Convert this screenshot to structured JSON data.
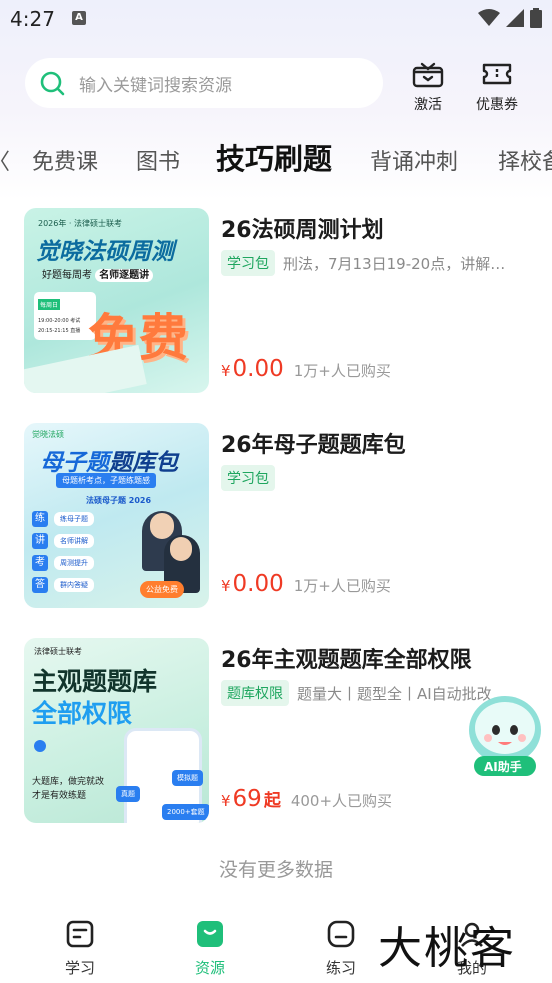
{
  "status_bar": {
    "time": "4:27",
    "notif_letter": "A"
  },
  "search": {
    "placeholder": "输入关键词搜索资源"
  },
  "top_actions": [
    {
      "label": "激活",
      "icon": "gift-icon"
    },
    {
      "label": "优惠券",
      "icon": "ticket-icon"
    }
  ],
  "tabs": [
    {
      "label": "免费课"
    },
    {
      "label": "图书"
    },
    {
      "label": "技巧刷题",
      "active": true
    },
    {
      "label": "背诵冲刺"
    },
    {
      "label": "择校备"
    }
  ],
  "products": [
    {
      "title": "26法硕周测计划",
      "tag": "学习包",
      "desc": "刑法，7月13日19-20点，讲解…",
      "price_symbol": "¥",
      "price": "0.00",
      "price_suffix": "",
      "sold": "1万+人已购买",
      "thumb": {
        "top_label": "2026年 · 法律硕士联考",
        "headline": "觉晓法硕周测",
        "sub": "好题每周考",
        "sub_highlight": "名师逐题讲",
        "schedule_title": "每周日",
        "schedule_1": "19:00-20:00 考试",
        "schedule_2": "20:15-21:15 直播",
        "big_text": "免费"
      }
    },
    {
      "title": "26年母子题题库包",
      "tag": "学习包",
      "desc": "",
      "price_symbol": "¥",
      "price": "0.00",
      "price_suffix": "",
      "sold": "1万+人已购买",
      "thumb": {
        "brand": "觉晓法硕",
        "headline_a": "母子题",
        "headline_b": "题库包",
        "banner": "母题析考点，子题练题感",
        "label": "法硕母子题 2026",
        "steps": [
          {
            "char": "练",
            "num": "1",
            "text": "练母子题"
          },
          {
            "char": "讲",
            "num": "2",
            "text": "名师讲解"
          },
          {
            "char": "考",
            "num": "3",
            "text": "周测提升"
          },
          {
            "char": "答",
            "num": "4",
            "text": "群内答疑"
          }
        ],
        "badge": "公益免费"
      }
    },
    {
      "title": "26年主观题题库全部权限",
      "tag": "题库权限",
      "desc": "题量大丨题型全丨AI自动批改",
      "price_symbol": "¥",
      "price": "69",
      "price_suffix": "起",
      "sold": "400+人已购买",
      "thumb": {
        "top_label": "法律硕士联考",
        "headline_a": "主观题题库",
        "headline_b": "全部权限",
        "body_1": "大题库，做完就改",
        "body_2": "才是有效练题",
        "chip_1": "模拟题",
        "chip_2": "真题",
        "chip_3": "2000+套题"
      }
    }
  ],
  "footer_note": "没有更多数据",
  "ai_helper": {
    "label": "AI助手"
  },
  "bottom_nav": [
    {
      "label": "学习",
      "icon": "study-icon"
    },
    {
      "label": "资源",
      "icon": "resource-icon",
      "active": true
    },
    {
      "label": "练习",
      "icon": "practice-icon"
    },
    {
      "label": "我的",
      "icon": "profile-icon"
    }
  ],
  "watermark": "大桃客",
  "colors": {
    "accent_green": "#1fbf7a",
    "price_red": "#ef3a24",
    "tag_bg": "#e4f6ec"
  }
}
